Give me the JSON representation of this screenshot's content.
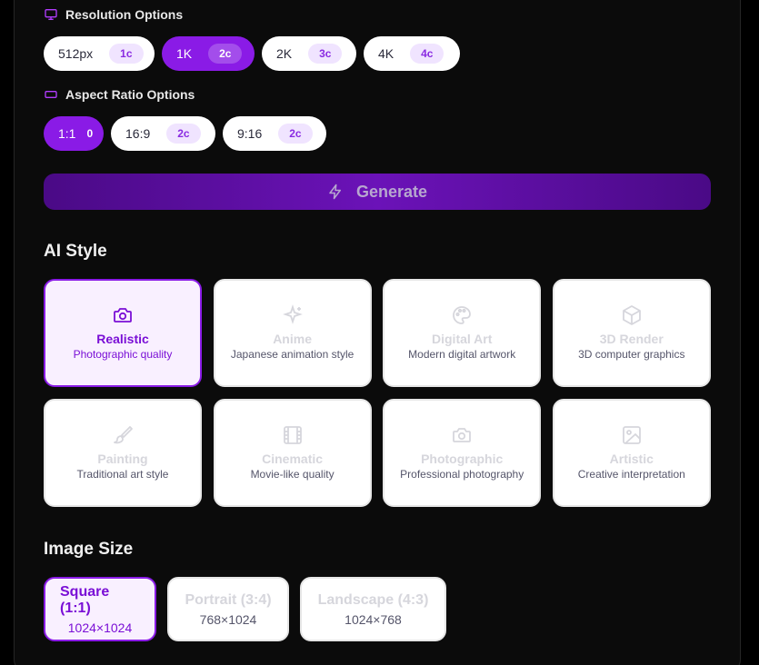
{
  "resolution": {
    "label": "Resolution Options",
    "options": [
      {
        "label": "512px",
        "cost": "1c",
        "selected": false
      },
      {
        "label": "1K",
        "cost": "2c",
        "selected": true
      },
      {
        "label": "2K",
        "cost": "3c",
        "selected": false
      },
      {
        "label": "4K",
        "cost": "4c",
        "selected": false
      }
    ]
  },
  "aspect_ratio": {
    "label": "Aspect Ratio Options",
    "options": [
      {
        "label": "1:1",
        "cost": "0",
        "selected": true
      },
      {
        "label": "16:9",
        "cost": "2c",
        "selected": false
      },
      {
        "label": "9:16",
        "cost": "2c",
        "selected": false
      }
    ]
  },
  "generate": {
    "label": "Generate"
  },
  "ai_style": {
    "title": "AI Style",
    "items": [
      {
        "title": "Realistic",
        "desc": "Photographic quality",
        "icon": "camera-icon",
        "selected": true
      },
      {
        "title": "Anime",
        "desc": "Japanese animation style",
        "icon": "sparkles-icon",
        "selected": false
      },
      {
        "title": "Digital Art",
        "desc": "Modern digital artwork",
        "icon": "palette-icon",
        "selected": false
      },
      {
        "title": "3D Render",
        "desc": "3D computer graphics",
        "icon": "cube-icon",
        "selected": false
      },
      {
        "title": "Painting",
        "desc": "Traditional art style",
        "icon": "brush-icon",
        "selected": false
      },
      {
        "title": "Cinematic",
        "desc": "Movie-like quality",
        "icon": "film-icon",
        "selected": false
      },
      {
        "title": "Photographic",
        "desc": "Professional photography",
        "icon": "camera-icon",
        "selected": false
      },
      {
        "title": "Artistic",
        "desc": "Creative interpretation",
        "icon": "image-icon",
        "selected": false
      }
    ]
  },
  "image_size": {
    "title": "Image Size",
    "items": [
      {
        "title": "Square (1:1)",
        "dims": "1024×1024",
        "selected": true
      },
      {
        "title": "Portrait (3:4)",
        "dims": "768×1024",
        "selected": false
      },
      {
        "title": "Landscape (4:3)",
        "dims": "1024×768",
        "selected": false
      }
    ]
  },
  "colors": {
    "accent": "#8a1be6",
    "background": "#000000",
    "card": "#ffffff",
    "muted_title": "#d6d6dc"
  }
}
